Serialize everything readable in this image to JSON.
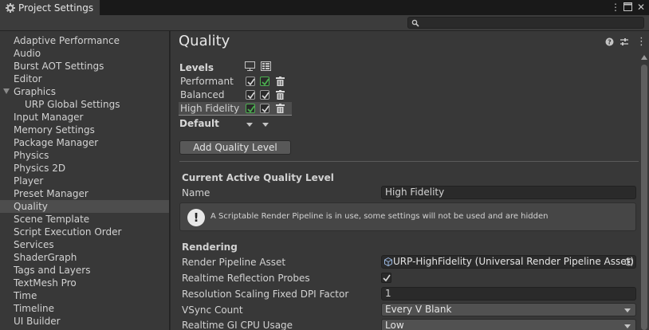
{
  "window": {
    "tab_title": "Project Settings",
    "search_placeholder": ""
  },
  "sidebar": {
    "items": [
      {
        "label": "Adaptive Performance"
      },
      {
        "label": "Audio"
      },
      {
        "label": "Burst AOT Settings"
      },
      {
        "label": "Editor"
      },
      {
        "label": "Graphics"
      },
      {
        "label": "URP Global Settings"
      },
      {
        "label": "Input Manager"
      },
      {
        "label": "Memory Settings"
      },
      {
        "label": "Package Manager"
      },
      {
        "label": "Physics"
      },
      {
        "label": "Physics 2D"
      },
      {
        "label": "Player"
      },
      {
        "label": "Preset Manager"
      },
      {
        "label": "Quality"
      },
      {
        "label": "Scene Template"
      },
      {
        "label": "Script Execution Order"
      },
      {
        "label": "Services"
      },
      {
        "label": "ShaderGraph"
      },
      {
        "label": "Tags and Layers"
      },
      {
        "label": "TextMesh Pro"
      },
      {
        "label": "Time"
      },
      {
        "label": "Timeline"
      },
      {
        "label": "UI Builder"
      }
    ],
    "selected": "Quality"
  },
  "main": {
    "title": "Quality",
    "levels_label": "Levels",
    "levels": [
      {
        "name": "Performant",
        "standalone": true,
        "mobile": true,
        "default_standalone": false,
        "default_mobile": true
      },
      {
        "name": "Balanced",
        "standalone": true,
        "mobile": true,
        "default_standalone": false,
        "default_mobile": false
      },
      {
        "name": "High Fidelity",
        "standalone": true,
        "mobile": true,
        "default_standalone": true,
        "default_mobile": false,
        "selected": true
      }
    ],
    "default_label": "Default",
    "add_button": "Add Quality Level",
    "current_section": "Current Active Quality Level",
    "name_label": "Name",
    "name_value": "High Fidelity",
    "help_text": "A Scriptable Render Pipeline is in use, some settings will not be used and are hidden",
    "rendering_section": "Rendering",
    "rpa_label": "Render Pipeline Asset",
    "rpa_value": "URP-HighFidelity (Universal Render Pipeline Asset)",
    "rrp_label": "Realtime Reflection Probes",
    "rrp_checked": true,
    "rsdpi_label": "Resolution Scaling Fixed DPI Factor",
    "rsdpi_value": "1",
    "vsync_label": "VSync Count",
    "vsync_value": "Every V Blank",
    "gicpu_label": "Realtime GI CPU Usage",
    "gicpu_value": "Low"
  },
  "colors": {
    "background": "#383838",
    "selection": "#4d4d4d",
    "default_check": "#4caf50"
  }
}
